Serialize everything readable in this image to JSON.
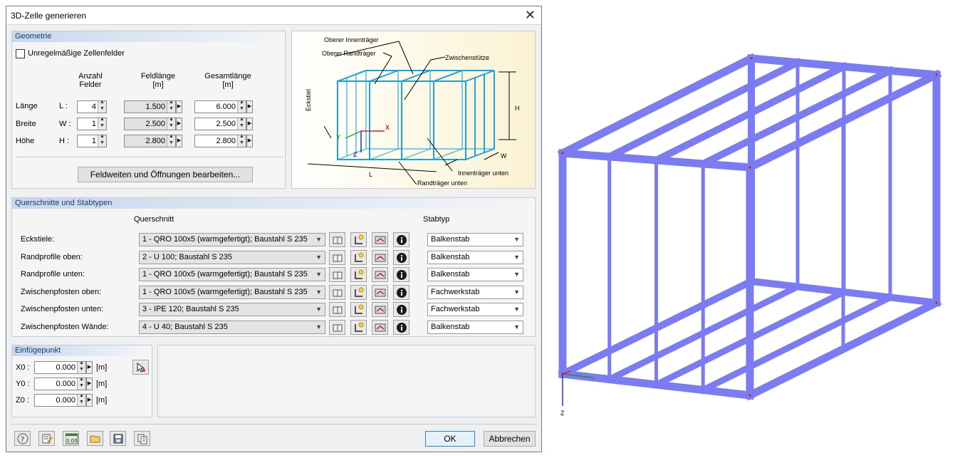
{
  "dialog": {
    "title": "3D-Zelle generieren"
  },
  "geometry": {
    "header": "Geometrie",
    "irregular_label": "Unregelmäßige Zellenfelder",
    "col_anzahl": "Anzahl",
    "col_felder": "Felder",
    "col_feldlaenge": "Feldlänge",
    "col_gesamtlaenge": "Gesamtlänge",
    "unit_m": "[m]",
    "rows": [
      {
        "name": "Länge",
        "symbol": "L :",
        "count": "4",
        "field": "1.500",
        "total": "6.000"
      },
      {
        "name": "Breite",
        "symbol": "W :",
        "count": "1",
        "field": "2.500",
        "total": "2.500"
      },
      {
        "name": "Höhe",
        "symbol": "H :",
        "count": "1",
        "field": "2.800",
        "total": "2.800"
      }
    ],
    "edit_button": "Feldweiten und Öffnungen bearbeiten..."
  },
  "diagram": {
    "oberer_innentraeger": "Oberer Innenträger",
    "oberer_randtraeger": "Oberer Randträger",
    "zwischenstuetze": "Zwischenstütze",
    "eckstiel": "Eckstiel",
    "h": "H",
    "w": "W",
    "l": "L",
    "x": "X",
    "y": "Y",
    "z": "Z",
    "innentraeger_unten": "Innenträger unten",
    "randtraeger_unten": "Randträger unten"
  },
  "sections": {
    "header": "Querschnitte und Stabtypen",
    "col_querschnitt": "Querschnitt",
    "col_stabtyp": "Stabtyp",
    "rows": [
      {
        "label": "Eckstiele:",
        "section": "1 - QRO 100x5 (warmgefertigt); Baustahl S 235",
        "type": "Balkenstab"
      },
      {
        "label": "Randprofile oben:",
        "section": "2 - U 100; Baustahl S 235",
        "type": "Balkenstab"
      },
      {
        "label": "Randprofile unten:",
        "section": "1 - QRO 100x5 (warmgefertigt); Baustahl S 235",
        "type": "Balkenstab"
      },
      {
        "label": "Zwischenpfosten oben:",
        "section": "1 - QRO 100x5 (warmgefertigt); Baustahl S 235",
        "type": "Fachwerkstab"
      },
      {
        "label": "Zwischenpfosten unten:",
        "section": "3 - IPE 120; Baustahl S 235",
        "type": "Fachwerkstab"
      },
      {
        "label": "Zwischenpfosten Wände:",
        "section": "4 - U 40; Baustahl S 235",
        "type": "Balkenstab"
      }
    ]
  },
  "insert": {
    "header": "Einfügepunkt",
    "rows": [
      {
        "label": "X0 :",
        "value": "0.000",
        "unit": "[m]"
      },
      {
        "label": "Y0 :",
        "value": "0.000",
        "unit": "[m]"
      },
      {
        "label": "Z0 :",
        "value": "0.000",
        "unit": "[m]"
      }
    ]
  },
  "footer": {
    "ok": "OK",
    "cancel": "Abbrechen",
    "calc_icon_text": "0.00"
  },
  "view": {
    "axis_y": "Y",
    "axis_z": "Z"
  },
  "colors": {
    "member": "#7b7cf3",
    "member_dark": "#5355c9",
    "diagram_line": "#1aa3e0",
    "header_text": "#1c3a6b"
  }
}
